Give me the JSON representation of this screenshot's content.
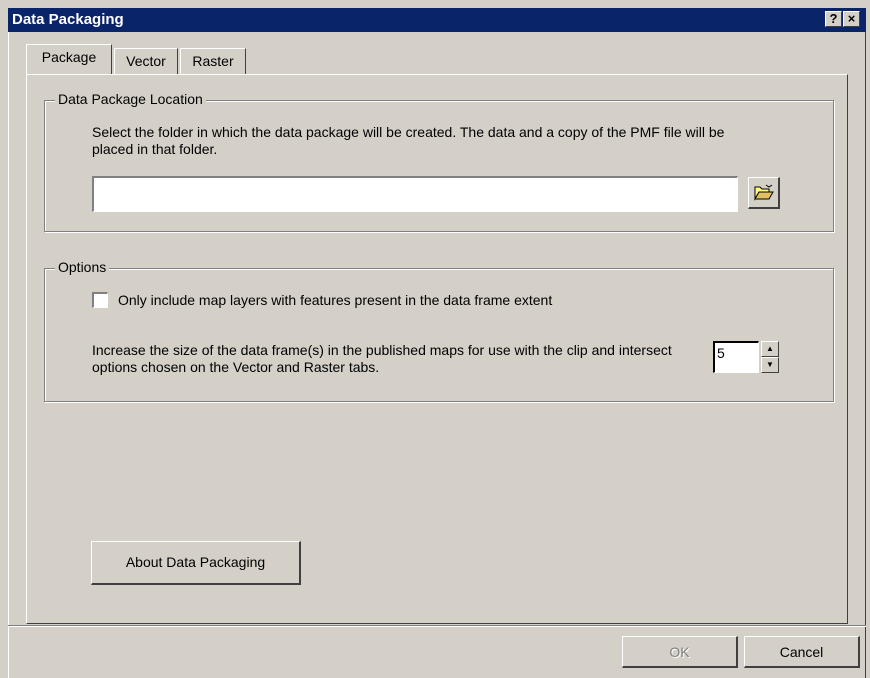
{
  "window": {
    "title": "Data Packaging",
    "help_glyph": "?",
    "close_glyph": "×"
  },
  "tabs": [
    {
      "label": "Package",
      "selected": true
    },
    {
      "label": "Vector",
      "selected": false
    },
    {
      "label": "Raster",
      "selected": false
    }
  ],
  "location_group": {
    "title": "Data Package Location",
    "description": "Select the folder in which the data package will be created. The data and a copy of the PMF file will be placed in that folder.",
    "folder_path": "",
    "browse_icon": "open-folder-icon"
  },
  "options_group": {
    "title": "Options",
    "only_include_label": "Only include map layers with features present in the data frame extent",
    "only_include_checked": false,
    "increase_description": "Increase the size of the data frame(s) in the published maps for use with the clip and intersect options chosen on the Vector and Raster tabs.",
    "increase_value": "5"
  },
  "buttons": {
    "about": "About Data Packaging",
    "ok": "OK",
    "ok_enabled": false,
    "cancel": "Cancel"
  },
  "colors": {
    "title_bar": "#0a246a",
    "face": "#d4d0c8"
  }
}
